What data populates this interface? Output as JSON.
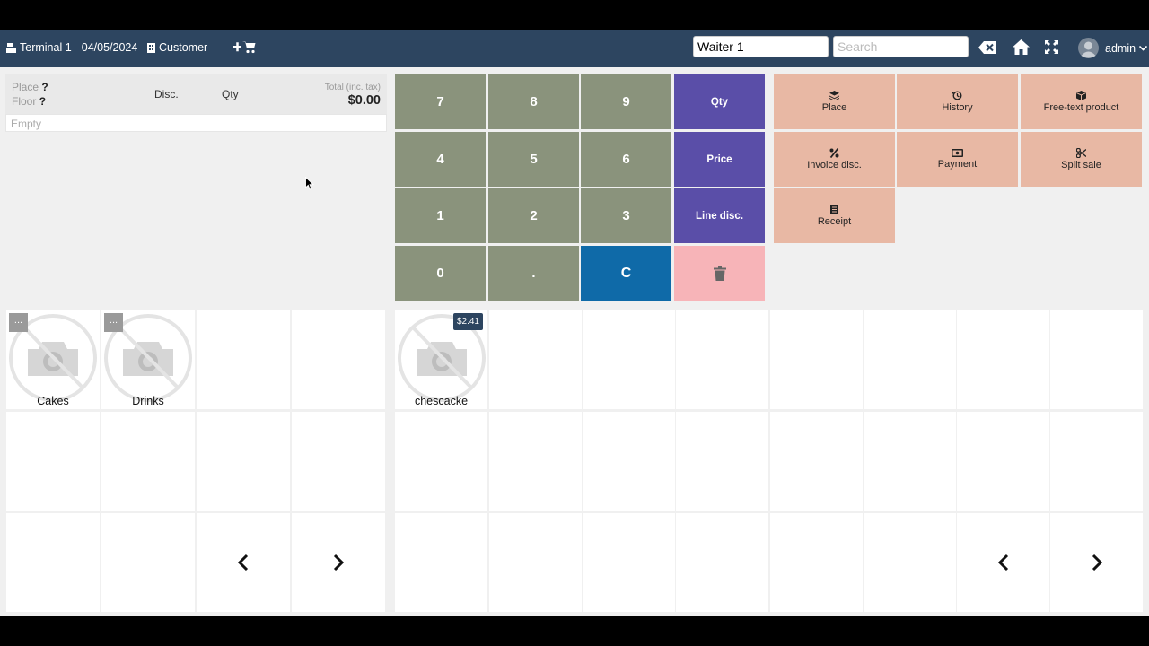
{
  "topbar": {
    "terminal": "Terminal 1 - 04/05/2024",
    "customer": "Customer",
    "waiter_value": "Waiter 1",
    "search_placeholder": "Search",
    "user": "admin"
  },
  "ticket": {
    "place_label": "Place",
    "floor_label": "Floor",
    "unknown": "?",
    "disc_label": "Disc.",
    "qty_label": "Qty",
    "total_label": "Total (inc. tax)",
    "total_value": "$0.00",
    "empty_text": "Empty"
  },
  "keypad": {
    "k7": "7",
    "k8": "8",
    "k9": "9",
    "qty": "Qty",
    "k4": "4",
    "k5": "5",
    "k6": "6",
    "price": "Price",
    "k1": "1",
    "k2": "2",
    "k3": "3",
    "line_disc": "Line disc.",
    "k0": "0",
    "dot": ".",
    "clear": "C"
  },
  "actions": {
    "place": "Place",
    "history": "History",
    "free_text": "Free-text product",
    "invoice_disc": "Invoice disc.",
    "payment": "Payment",
    "split_sale": "Split sale",
    "receipt": "Receipt"
  },
  "categories": {
    "more_label": "...",
    "items": [
      {
        "name": "Cakes"
      },
      {
        "name": "Drinks"
      }
    ]
  },
  "products": {
    "items": [
      {
        "name": "chescacke",
        "price": "$2.41"
      }
    ]
  }
}
